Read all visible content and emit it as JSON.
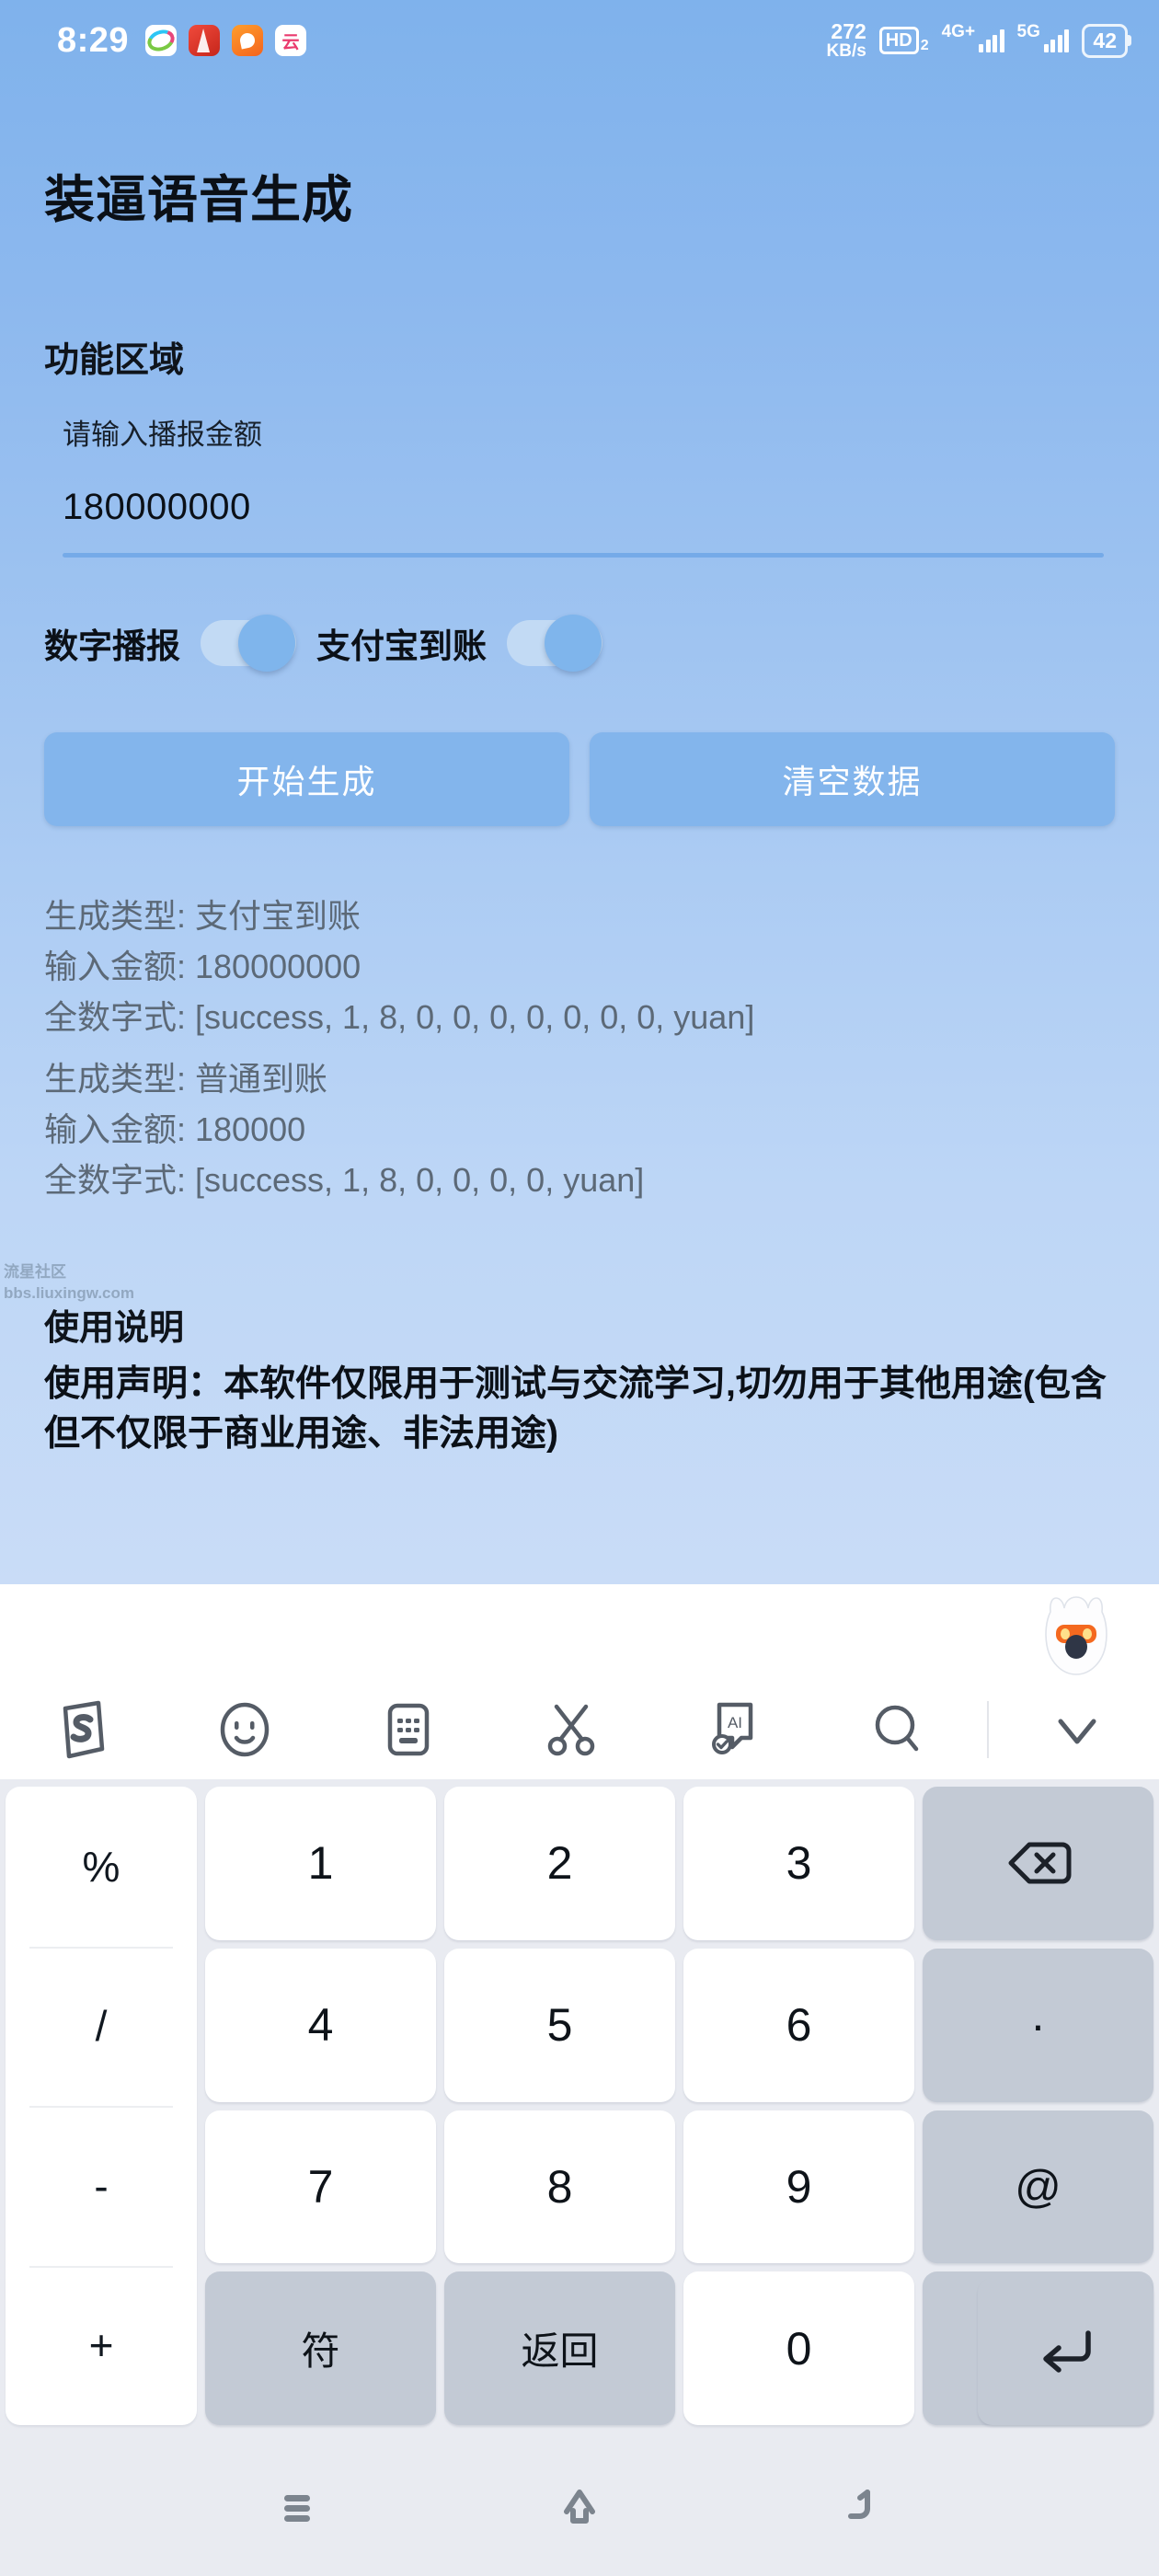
{
  "status_bar": {
    "time": "8:29",
    "app_icons": [
      "qq-icon",
      "red-app-icon",
      "orange-app-icon",
      "pink-app-icon"
    ],
    "network_speed_value": "272",
    "network_speed_unit": "KB/s",
    "hd_label": "HD",
    "hd_sub": "2",
    "signal_1_label": "4G+",
    "signal_2_label": "5G",
    "battery": "42"
  },
  "app": {
    "title": "装逼语音生成",
    "function_section_title": "功能区域",
    "amount_field": {
      "label": "请输入播报金额",
      "value": "180000000",
      "placeholder": "请输入播报金额"
    },
    "toggles": [
      {
        "label": "数字播报",
        "on": true
      },
      {
        "label": "支付宝到账",
        "on": true
      }
    ],
    "buttons": {
      "generate": "开始生成",
      "clear": "清空数据"
    },
    "results": [
      {
        "type_line": "生成类型: 支付宝到账",
        "amount_line": "输入金额: 180000000",
        "digits_line": "全数字式: [success, 1, 8, 0, 0, 0, 0, 0, 0, 0, yuan]"
      },
      {
        "type_line": "生成类型: 普通到账",
        "amount_line": "输入金额: 180000",
        "digits_line": "全数字式: [success, 1, 8, 0, 0, 0, 0, yuan]"
      }
    ],
    "usage_section_title": "使用说明",
    "usage_text": "使用声明：本软件仅限用于测试与交流学习,切勿用于其他用途(包含但不仅限于商业用途、非法用途)",
    "watermark_line1": "流星社区",
    "watermark_line2": "bbs.liuxingw.com"
  },
  "keyboard": {
    "toolbar_icons": [
      "sogou-logo-icon",
      "emoji-icon",
      "keyboard-switch-icon",
      "scissors-icon",
      "ai-card-icon",
      "search-icon",
      "chevron-down-icon"
    ],
    "mascot": "sogou-mascot-icon",
    "op_keys": [
      "%",
      "/",
      "-",
      "+"
    ],
    "grid_keys": [
      {
        "label": "1",
        "type": "num"
      },
      {
        "label": "2",
        "type": "num"
      },
      {
        "label": "3",
        "type": "num"
      },
      {
        "label": "",
        "type": "fn",
        "icon": "backspace-icon"
      },
      {
        "label": "4",
        "type": "num"
      },
      {
        "label": "5",
        "type": "num"
      },
      {
        "label": "6",
        "type": "num"
      },
      {
        "label": "·",
        "type": "fn"
      },
      {
        "label": "7",
        "type": "num"
      },
      {
        "label": "8",
        "type": "num"
      },
      {
        "label": "9",
        "type": "num"
      },
      {
        "label": "@",
        "type": "fn"
      },
      {
        "label": "符",
        "type": "fn-cn"
      },
      {
        "label": "返回",
        "type": "fn-cn"
      },
      {
        "label": "0",
        "type": "num"
      },
      {
        "label": "",
        "type": "fn",
        "icon": "space-icon"
      },
      {
        "label": "",
        "type": "fn",
        "icon": "enter-icon"
      }
    ]
  },
  "nav_bar": {
    "recents": "recents-icon",
    "home": "home-icon",
    "back": "back-icon"
  },
  "colors": {
    "bg_top": "#7fb2ec",
    "bg_bottom": "#c9dcf7",
    "button": "#83b5ec",
    "switch_track": "#c2daf4",
    "switch_knob": "#7fb5ec",
    "result_text": "#5c6977",
    "keyboard_bg": "#e9ebf1",
    "fn_key": "#c3cad5"
  }
}
